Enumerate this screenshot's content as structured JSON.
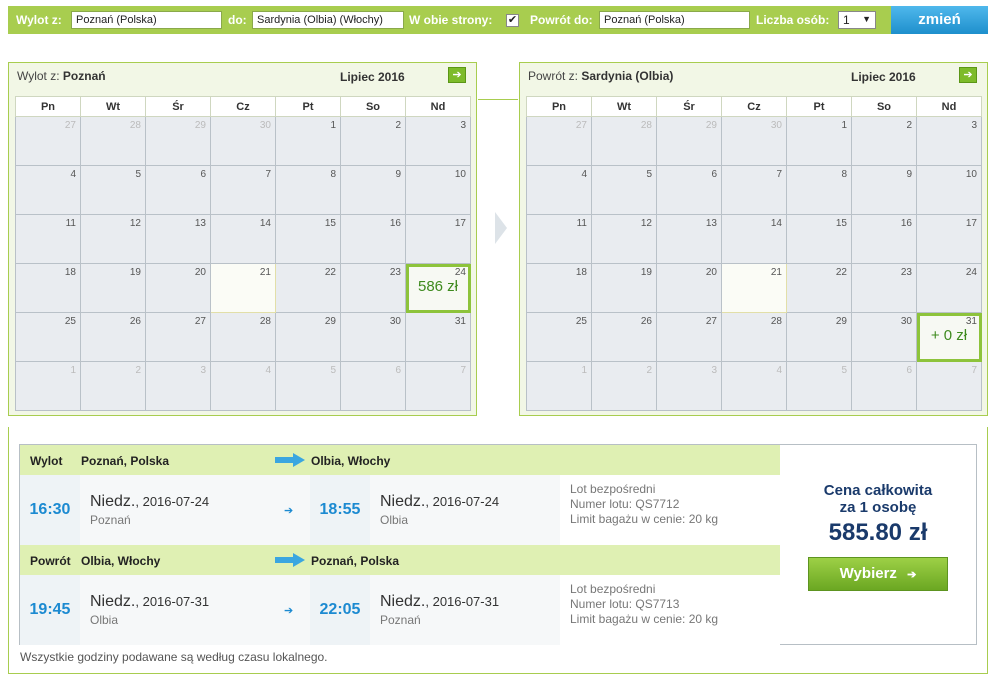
{
  "search": {
    "from_label": "Wylot z:",
    "from_value": "Poznań (Polska)",
    "to_label": "do:",
    "to_value": "Sardynia (Olbia) (Włochy)",
    "both_ways_label": "W obie strony:",
    "both_ways_checked": "✔",
    "return_label": "Powrót do:",
    "return_value": "Poznań (Polska)",
    "persons_label": "Liczba osób:",
    "persons_value": "1",
    "change_button": "zmień"
  },
  "calendars": [
    {
      "from_label": "Wylot z:",
      "from_city": "Poznań",
      "month": "Lipiec 2016",
      "weekdays": [
        "Pn",
        "Wt",
        "Śr",
        "Cz",
        "Pt",
        "So",
        "Nd"
      ],
      "weeks": [
        [
          "27",
          "28",
          "29",
          "30",
          "1",
          "2",
          "3"
        ],
        [
          "4",
          "5",
          "6",
          "7",
          "8",
          "9",
          "10"
        ],
        [
          "11",
          "12",
          "13",
          "14",
          "15",
          "16",
          "17"
        ],
        [
          "18",
          "19",
          "20",
          "21",
          "22",
          "23",
          "24"
        ],
        [
          "25",
          "26",
          "27",
          "28",
          "29",
          "30",
          "31"
        ],
        [
          "1",
          "2",
          "3",
          "4",
          "5",
          "6",
          "7"
        ]
      ],
      "selected_day": "24",
      "price": "586 zł"
    },
    {
      "from_label": "Powrót z:",
      "from_city": "Sardynia (Olbia)",
      "month": "Lipiec 2016",
      "weekdays": [
        "Pn",
        "Wt",
        "Śr",
        "Cz",
        "Pt",
        "So",
        "Nd"
      ],
      "weeks": [
        [
          "27",
          "28",
          "29",
          "30",
          "1",
          "2",
          "3"
        ],
        [
          "4",
          "5",
          "6",
          "7",
          "8",
          "9",
          "10"
        ],
        [
          "11",
          "12",
          "13",
          "14",
          "15",
          "16",
          "17"
        ],
        [
          "18",
          "19",
          "20",
          "21",
          "22",
          "23",
          "24"
        ],
        [
          "25",
          "26",
          "27",
          "28",
          "29",
          "30",
          "31"
        ],
        [
          "1",
          "2",
          "3",
          "4",
          "5",
          "6",
          "7"
        ]
      ],
      "selected_day": "31",
      "price": "+ 0 zł"
    }
  ],
  "outbound": {
    "label": "Wylot",
    "from": "Poznań, Polska",
    "to": "Olbia, Włochy",
    "dep_time": "16:30",
    "dep_day": "Niedz.",
    "dep_date": ", 2016-07-24",
    "dep_city": "Poznań",
    "arr_time": "18:55",
    "arr_day": "Niedz.",
    "arr_date": ", 2016-07-24",
    "arr_city": "Olbia",
    "info1": "Lot bezpośredni",
    "info2": "Numer lotu: QS7712",
    "info3": "Limit bagażu w cenie: 20 kg"
  },
  "inbound": {
    "label": "Powrót",
    "from": "Olbia, Włochy",
    "to": "Poznań, Polska",
    "dep_time": "19:45",
    "dep_day": "Niedz.",
    "dep_date": ", 2016-07-31",
    "dep_city": "Olbia",
    "arr_time": "22:05",
    "arr_day": "Niedz.",
    "arr_date": ", 2016-07-31",
    "arr_city": "Poznań",
    "info1": "Lot bezpośredni",
    "info2": "Numer lotu: QS7713",
    "info3": "Limit bagażu w cenie: 20 kg"
  },
  "price": {
    "title_line1": "Cena całkowita",
    "title_line2": "za 1 osobę",
    "total": "585.80 zł",
    "select_button": "Wybierz",
    "arrow": "➔"
  },
  "footnote": "Wszystkie godziny podawane są według czasu lokalnego.",
  "colors": {
    "accent_green": "#a8cd4f",
    "button_blue": "#1e8fcc",
    "time_blue": "#1c8ad1",
    "price_navy": "#1a3a6b"
  }
}
